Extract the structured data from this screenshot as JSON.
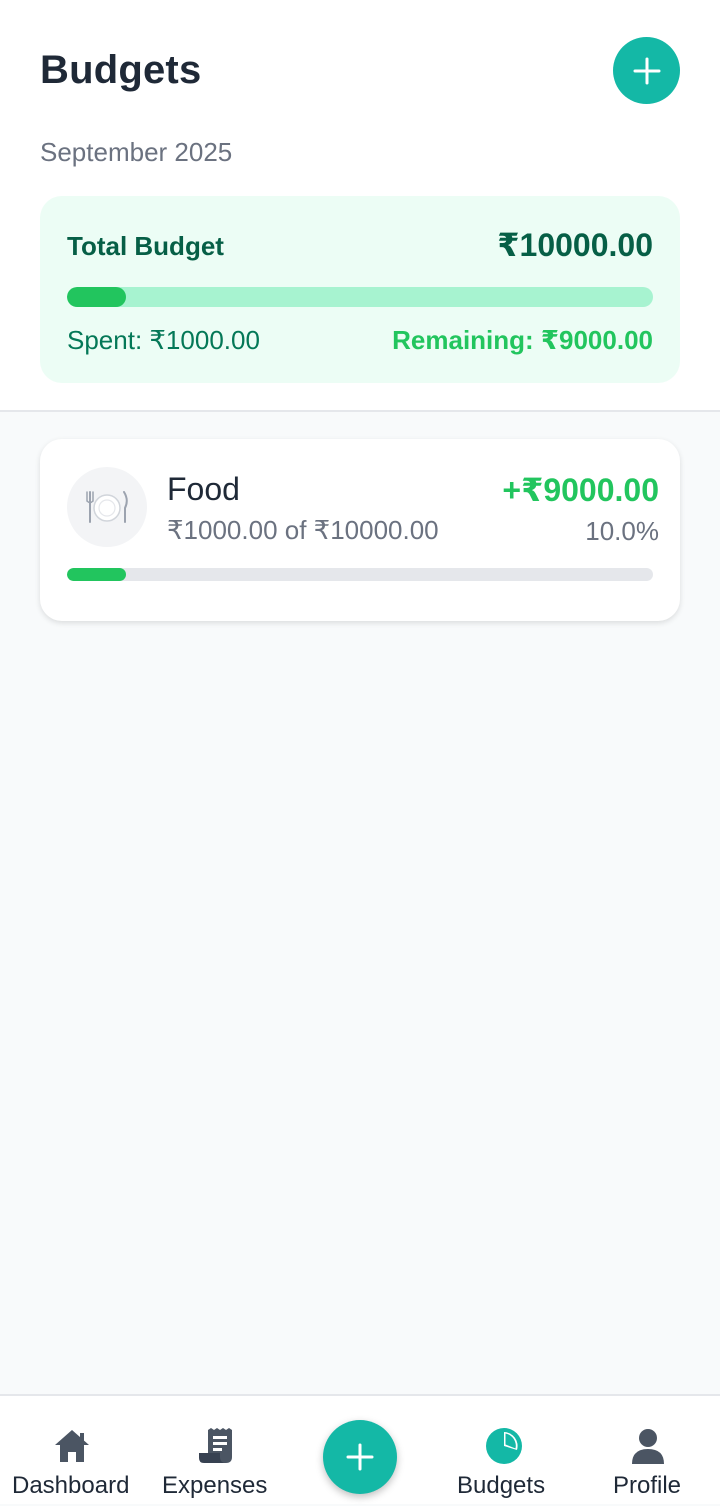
{
  "header": {
    "title": "Budgets",
    "month": "September 2025",
    "add_button_icon": "plus-icon"
  },
  "summary": {
    "label": "Total Budget",
    "total": "₹10000.00",
    "spent": "Spent: ₹1000.00",
    "remaining": "Remaining: ₹9000.00",
    "progress_fraction": 0.1
  },
  "budgets": [
    {
      "icon": "fork-knife-plate-icon",
      "name": "Food",
      "progress_text": "₹1000.00 of ₹10000.00",
      "remaining": "+₹9000.00",
      "percent": "10.0%",
      "progress_fraction": 0.1
    }
  ],
  "nav": {
    "items": [
      {
        "label": "Dashboard",
        "icon": "home-icon",
        "active": false
      },
      {
        "label": "Expenses",
        "icon": "receipt-icon",
        "active": false
      },
      {
        "label": "Budgets",
        "icon": "pie-chart-icon",
        "active": true
      },
      {
        "label": "Profile",
        "icon": "person-icon",
        "active": false
      }
    ],
    "fab_icon": "plus-icon"
  },
  "colors": {
    "accent": "#14b8a6",
    "success": "#22c55e",
    "summary_bg": "#ecfdf5",
    "summary_text": "#065f46"
  }
}
